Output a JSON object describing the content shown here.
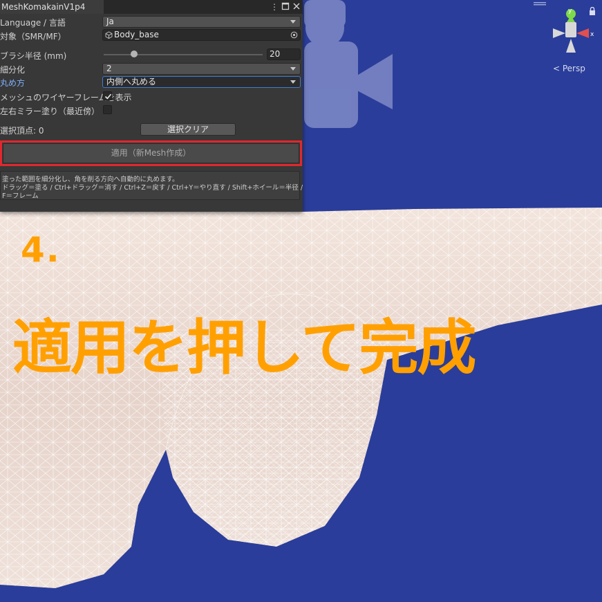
{
  "window": {
    "title": "MeshKomakainV1p4",
    "menu_icon": "kebab-menu-icon",
    "maximize_icon": "maximize-icon",
    "close_icon": "close-icon"
  },
  "fields": {
    "language_label": "Language / 言語",
    "language_value": "Ja",
    "target_label": "対象（SMR/MF）",
    "target_value": "Body_base",
    "brush_label": "ブラシ半径 (mm)",
    "brush_value": "20",
    "brush_level_fraction": 0.19,
    "subdiv_label": "細分化",
    "subdiv_value": "2",
    "round_label": "丸め方",
    "round_value": "内側へ丸める",
    "wireframe_label": "メッシュのワイヤーフレームを表示",
    "wireframe_checked": true,
    "mirror_label": "左右ミラー塗り（最近傍）",
    "mirror_checked": false,
    "selected_label": "選択頂点: 0",
    "clear_button": "選択クリア",
    "apply_button": "適用（新Mesh作成）"
  },
  "help": {
    "line1": "塗った範囲を細分化し、角を削る方向へ自動的に丸めます。",
    "line2": "ドラッグ＝塗る / Ctrl+ドラッグ＝消す / Ctrl+Z＝戻す / Ctrl+Y＝やり直す / Shift+ホイール＝半径 /",
    "line3": "F＝フレーム"
  },
  "scene": {
    "persp_label": "< Persp",
    "axis_x_label": "x",
    "axis_y_label": "y",
    "background_color": "#2a3d9a",
    "mesh_color": "#ecdcd4"
  },
  "overlay": {
    "step": "4.",
    "headline": "適用を押して完成",
    "accent_color": "#ffa000",
    "highlight_color": "#e0282e"
  }
}
